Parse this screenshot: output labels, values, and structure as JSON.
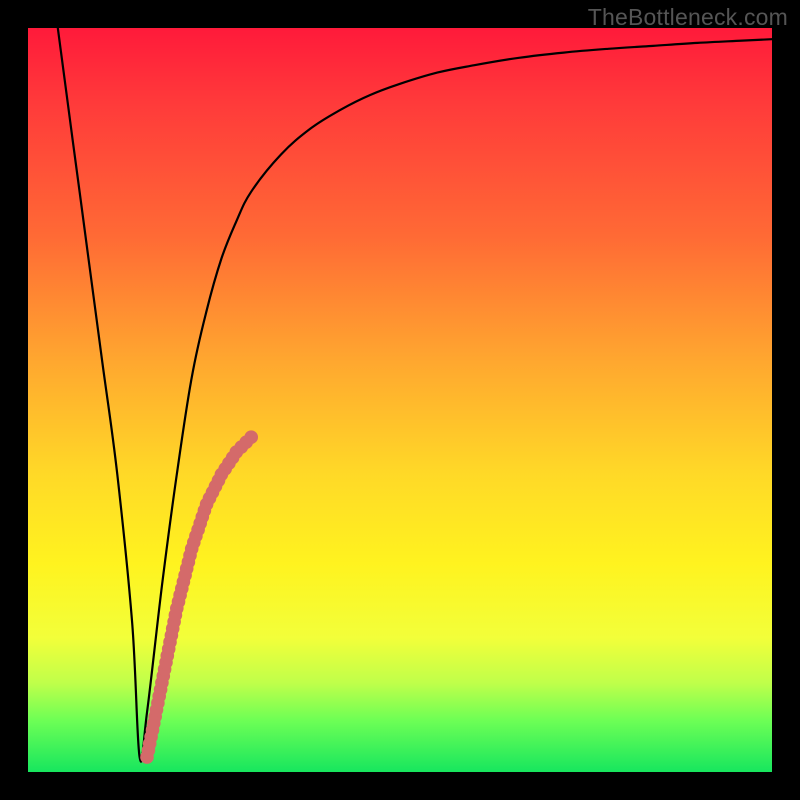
{
  "watermark": "TheBottleneck.com",
  "chart_data": {
    "type": "line",
    "title": "",
    "xlabel": "",
    "ylabel": "",
    "xlim": [
      0,
      100
    ],
    "ylim": [
      0,
      100
    ],
    "grid": false,
    "legend": false,
    "series": [
      {
        "name": "curve",
        "color": "#000000",
        "x": [
          4,
          6,
          8,
          10,
          12,
          14,
          15,
          16,
          18,
          20,
          22,
          24,
          26,
          28,
          30,
          34,
          38,
          42,
          46,
          50,
          55,
          60,
          66,
          72,
          78,
          84,
          90,
          96,
          100
        ],
        "values": [
          100,
          85,
          70,
          55,
          40,
          20,
          2,
          8,
          25,
          40,
          53,
          62,
          69,
          74,
          78,
          83,
          86.5,
          89,
          91,
          92.5,
          94,
          95,
          96,
          96.7,
          97.2,
          97.6,
          98,
          98.3,
          98.5
        ]
      },
      {
        "name": "highlight-segment",
        "color": "#d46a6a",
        "x": [
          16,
          18,
          20,
          22,
          24,
          26,
          28,
          30
        ],
        "values": [
          2,
          12,
          22,
          30,
          36,
          40,
          43,
          45
        ]
      }
    ]
  }
}
